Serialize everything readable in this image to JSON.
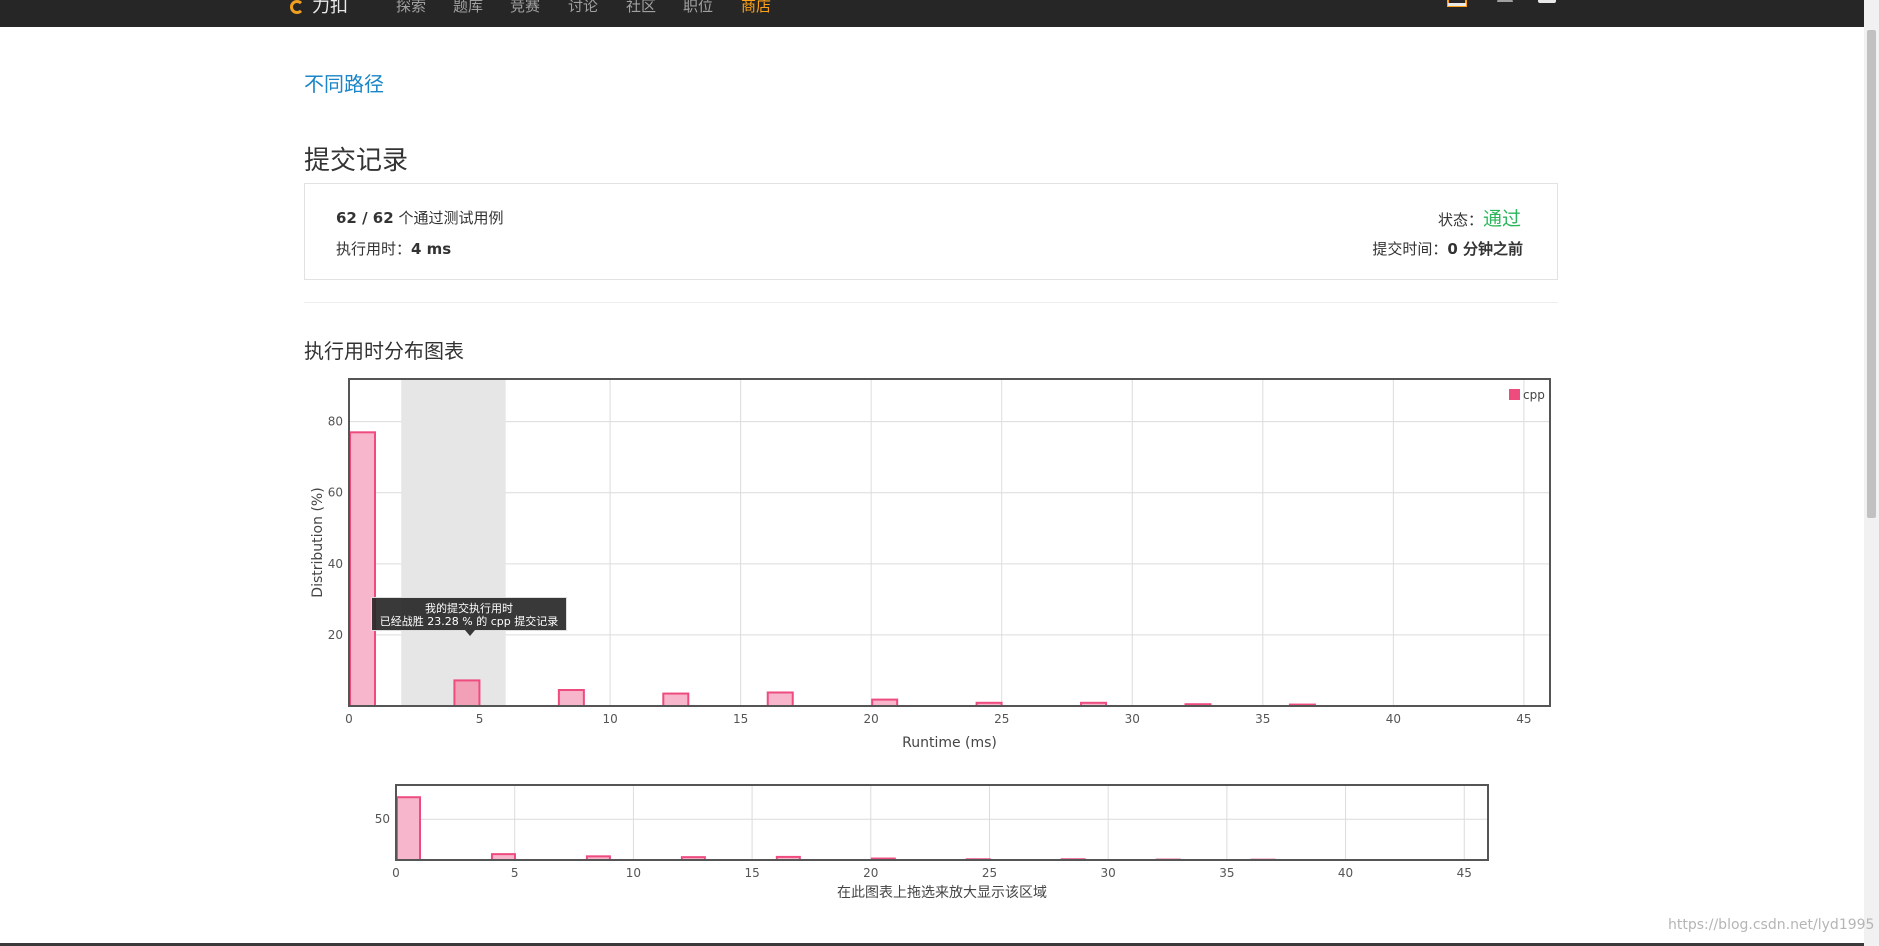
{
  "nav": {
    "logo_text": "力扣",
    "items": [
      "探索",
      "题库",
      "竞赛",
      "讨论",
      "社区",
      "职位",
      "商店"
    ],
    "active_index": 6
  },
  "problem": {
    "title": "不同路径"
  },
  "submission": {
    "section_title": "提交记录",
    "tests_passed": "62 / 62",
    "tests_suffix": " 个通过测试用例",
    "runtime_label": "执行用时：",
    "runtime_value": "4 ms",
    "status_label": "状态：",
    "status_value": "通过",
    "time_label": "提交时间：",
    "time_value": "0 分钟之前"
  },
  "chart_section_title": "执行用时分布图表",
  "tooltip": {
    "line1": "我的提交执行用时",
    "line2": "已经战胜 23.28 % 的 cpp 提交记录"
  },
  "chart_data": [
    {
      "type": "bar",
      "x": [
        0,
        4,
        8,
        12,
        16,
        20,
        24,
        28,
        32,
        36
      ],
      "values": [
        77,
        7.2,
        4.5,
        3.5,
        3.8,
        1.8,
        0.9,
        0.9,
        0.5,
        0.4
      ],
      "series": [
        {
          "name": "cpp",
          "color": "#ee4b7f"
        }
      ],
      "xlabel": "Runtime (ms)",
      "ylabel": "Distribution (%)",
      "xlim": [
        0,
        46
      ],
      "ylim": [
        0,
        92
      ],
      "xticks": [
        0,
        5,
        10,
        15,
        20,
        25,
        30,
        35,
        40,
        45
      ],
      "yticks": [
        20,
        40,
        60,
        80
      ],
      "highlight_range": [
        2,
        6
      ],
      "grid": true,
      "legend": "top-right"
    },
    {
      "type": "bar",
      "x": [
        0,
        4,
        8,
        12,
        16,
        20,
        24,
        28,
        32,
        36
      ],
      "values": [
        77,
        7.2,
        4.5,
        3.5,
        3.8,
        1.8,
        0.9,
        0.9,
        0.5,
        0.4
      ],
      "xlim": [
        0,
        46
      ],
      "ylim": [
        0,
        92
      ],
      "xticks": [
        0,
        5,
        10,
        15,
        20,
        25,
        30,
        35,
        40,
        45
      ],
      "yticks": [
        50
      ],
      "xlabel": "在此图表上拖选来放大显示该区域",
      "grid": true
    }
  ],
  "watermark": "https://blog.csdn.net/lyd1995"
}
